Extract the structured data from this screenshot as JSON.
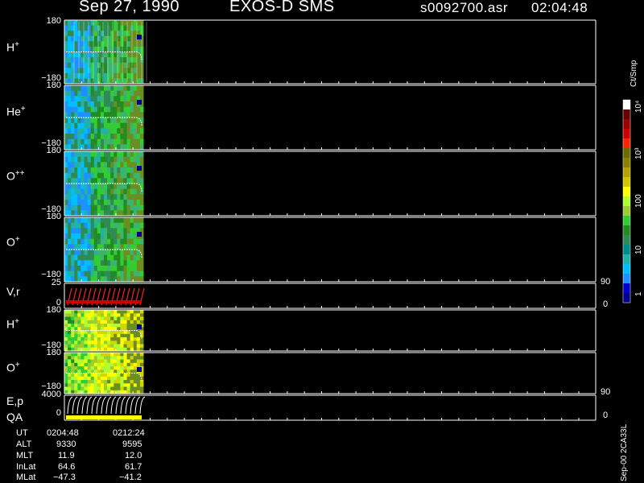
{
  "header": {
    "date": "Sep 27, 1990",
    "instrument": "EXOS-D SMS",
    "file": "s0092700.asr",
    "time": "02:04:48"
  },
  "colors": {
    "white": "#ffffff",
    "red_line": "#ff2020",
    "qa_bar": "#ffff00"
  },
  "chart_data": {
    "type": "heatmap",
    "panels": [
      {
        "label": "H",
        "sup": "+",
        "ylim": [
          -180,
          180
        ],
        "top_tick": "180",
        "bottom_tick": "−180"
      },
      {
        "label": "He",
        "sup": "+",
        "ylim": [
          -180,
          180
        ],
        "top_tick": "180",
        "bottom_tick": "−180"
      },
      {
        "label": "O",
        "sup": "++",
        "ylim": [
          -180,
          180
        ],
        "top_tick": "180",
        "bottom_tick": "−180"
      },
      {
        "label": "O",
        "sup": "+",
        "ylim": [
          -180,
          180
        ],
        "top_tick": "180",
        "bottom_tick": "−180"
      },
      {
        "label": "V,r",
        "sup": "",
        "ylim": [
          0,
          25
        ],
        "top_tick": "25",
        "bottom_tick": "0",
        "right_top": "90",
        "right_bottom": "0"
      },
      {
        "label": "H",
        "sup": "+",
        "ylim": [
          -180,
          180
        ],
        "top_tick": "180",
        "bottom_tick": "−180"
      },
      {
        "label": "O",
        "sup": "+",
        "ylim": [
          -180,
          180
        ],
        "top_tick": "180",
        "bottom_tick": "−180"
      },
      {
        "label": "E,p",
        "label2": "QA",
        "sup": "",
        "ylim": [
          0,
          4000
        ],
        "top_tick": "4000",
        "bottom_tick": "0",
        "right_top": "90",
        "right_bottom": "0"
      }
    ],
    "colorbar": {
      "unit": "Ct/Smp",
      "ticks": [
        "1",
        "10",
        "100",
        "10³",
        "10⁴"
      ],
      "colors": [
        "#00008b",
        "#0000cd",
        "#1e90ff",
        "#00bfff",
        "#20b2aa",
        "#008b8b",
        "#2e8b57",
        "#228b22",
        "#32cd32",
        "#9acd32",
        "#adff2f",
        "#ffff00",
        "#d4c400",
        "#b8a000",
        "#8b8000",
        "#6b6b00",
        "#ff2200",
        "#cc0000",
        "#990000",
        "#660000",
        "#ffffff"
      ]
    }
  },
  "ephemeris": {
    "rows": [
      {
        "name": "UT",
        "v1": "0204:48",
        "v2": "0212:24"
      },
      {
        "name": "ALT",
        "v1": "9330",
        "v2": "9595"
      },
      {
        "name": "MLT",
        "v1": "11.9",
        "v2": "12.0"
      },
      {
        "name": "InLat",
        "v1": "64.6",
        "v2": "61.7"
      },
      {
        "name": "MLat",
        "v1": "−47.3",
        "v2": "−41.2"
      }
    ]
  },
  "footer_id": "Sep-00 2CA33L"
}
